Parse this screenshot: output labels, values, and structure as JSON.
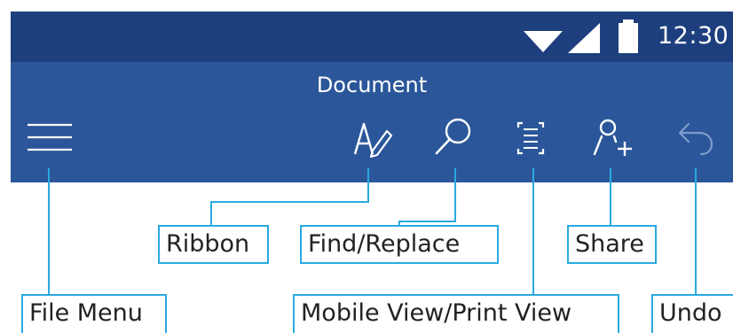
{
  "status_bar": {
    "time": "12:30",
    "icons": [
      "wifi-icon",
      "cell-signal-icon",
      "battery-icon"
    ],
    "color": "#1e3f7e"
  },
  "app_bar": {
    "title": "Document",
    "color": "#2b579a",
    "buttons": [
      "menu-icon",
      "pen-icon",
      "search-icon",
      "view-toggle-icon",
      "add-person-icon",
      "undo-icon"
    ]
  },
  "callouts": {
    "ribbon": "Ribbon",
    "find_replace": "Find/Replace",
    "share": "Share",
    "file_menu": "File Menu",
    "mobile_print_view": "Mobile View/Print View",
    "undo": "Undo",
    "accent_color": "#29aae1"
  }
}
